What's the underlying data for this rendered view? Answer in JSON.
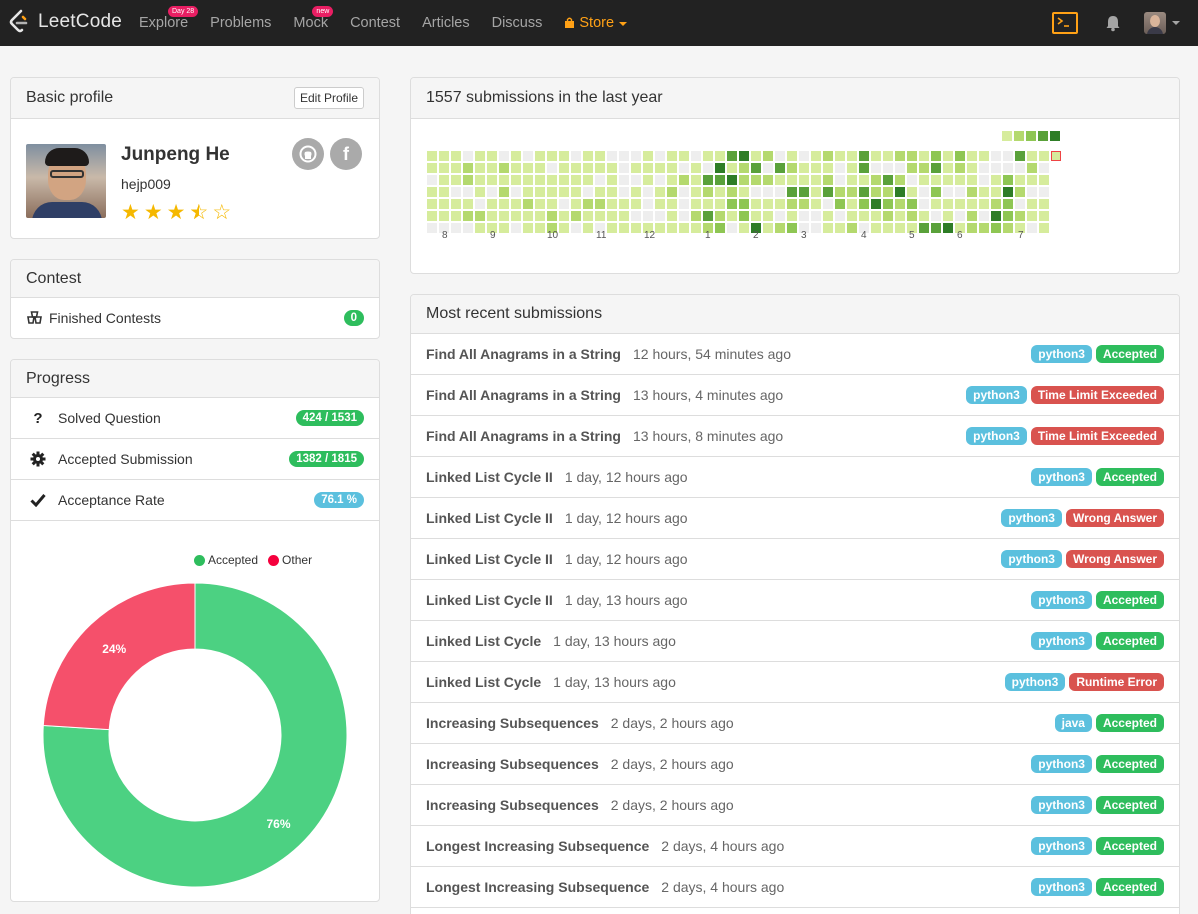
{
  "nav": {
    "logo_text": "LeetCode",
    "links": [
      {
        "label": "Explore",
        "badge": "Day 28"
      },
      {
        "label": "Problems",
        "badge": ""
      },
      {
        "label": "Mock",
        "badge": "new"
      },
      {
        "label": "Contest",
        "badge": ""
      },
      {
        "label": "Articles",
        "badge": ""
      },
      {
        "label": "Discuss",
        "badge": ""
      }
    ],
    "store_label": "Store",
    "colors": {
      "bar": "#222222",
      "accent": "#ffa116",
      "badge": "#e91e63"
    },
    "icons": [
      "store-bag-icon",
      "console-icon",
      "bell-icon",
      "user-avatar"
    ]
  },
  "profile": {
    "header": "Basic profile",
    "edit_label": "Edit Profile",
    "name": "Junpeng He",
    "username": "hejp009",
    "rating_stars": 3.5,
    "rating_max": 5,
    "social_icons": [
      "github-icon",
      "facebook-icon"
    ]
  },
  "contest": {
    "header": "Contest",
    "rows": [
      {
        "label": "Finished Contests",
        "value": "0",
        "icon": "trophies-icon"
      }
    ]
  },
  "progress": {
    "header": "Progress",
    "rows": [
      {
        "label": "Solved Question",
        "value": "424 / 1531",
        "icon": "question-icon",
        "color": "green"
      },
      {
        "label": "Accepted Submission",
        "value": "1382 / 1815",
        "icon": "gear-icon",
        "color": "green"
      },
      {
        "label": "Acceptance Rate",
        "value": "76.1 %",
        "icon": "check-icon",
        "color": "blue"
      }
    ]
  },
  "chart_data": {
    "type": "pie",
    "categories": [
      "Accepted",
      "Other"
    ],
    "values": [
      76,
      24
    ],
    "labels": [
      "76%",
      "24%"
    ],
    "colors": [
      "#4cd182",
      "#f5506b"
    ],
    "legend_position": "top-right"
  },
  "heatmap": {
    "title": "1557 submissions in the last year",
    "months": [
      "8",
      "9",
      "10",
      "11",
      "12",
      "1",
      "2",
      "3",
      "4",
      "5",
      "6",
      "7"
    ],
    "legend_colors": [
      "#d6ec9c",
      "#b4d96e",
      "#8ec653",
      "#5aa13a",
      "#2e7d26"
    ],
    "empty_color": "#eeeeee"
  },
  "recent": {
    "header": "Most recent submissions",
    "items": [
      {
        "title": "Find All Anagrams in a String",
        "time": "12 hours, 54 minutes ago",
        "lang": "python3",
        "status": "Accepted",
        "ok": true
      },
      {
        "title": "Find All Anagrams in a String",
        "time": "13 hours, 4 minutes ago",
        "lang": "python3",
        "status": "Time Limit Exceeded",
        "ok": false
      },
      {
        "title": "Find All Anagrams in a String",
        "time": "13 hours, 8 minutes ago",
        "lang": "python3",
        "status": "Time Limit Exceeded",
        "ok": false
      },
      {
        "title": "Linked List Cycle II",
        "time": "1 day, 12 hours ago",
        "lang": "python3",
        "status": "Accepted",
        "ok": true
      },
      {
        "title": "Linked List Cycle II",
        "time": "1 day, 12 hours ago",
        "lang": "python3",
        "status": "Wrong Answer",
        "ok": false
      },
      {
        "title": "Linked List Cycle II",
        "time": "1 day, 12 hours ago",
        "lang": "python3",
        "status": "Wrong Answer",
        "ok": false
      },
      {
        "title": "Linked List Cycle II",
        "time": "1 day, 13 hours ago",
        "lang": "python3",
        "status": "Accepted",
        "ok": true
      },
      {
        "title": "Linked List Cycle",
        "time": "1 day, 13 hours ago",
        "lang": "python3",
        "status": "Accepted",
        "ok": true
      },
      {
        "title": "Linked List Cycle",
        "time": "1 day, 13 hours ago",
        "lang": "python3",
        "status": "Runtime Error",
        "ok": false
      },
      {
        "title": "Increasing Subsequences",
        "time": "2 days, 2 hours ago",
        "lang": "java",
        "status": "Accepted",
        "ok": true
      },
      {
        "title": "Increasing Subsequences",
        "time": "2 days, 2 hours ago",
        "lang": "python3",
        "status": "Accepted",
        "ok": true
      },
      {
        "title": "Increasing Subsequences",
        "time": "2 days, 2 hours ago",
        "lang": "python3",
        "status": "Accepted",
        "ok": true
      },
      {
        "title": "Longest Increasing Subsequence",
        "time": "2 days, 4 hours ago",
        "lang": "python3",
        "status": "Accepted",
        "ok": true
      },
      {
        "title": "Longest Increasing Subsequence",
        "time": "2 days, 4 hours ago",
        "lang": "python3",
        "status": "Accepted",
        "ok": true
      }
    ]
  }
}
